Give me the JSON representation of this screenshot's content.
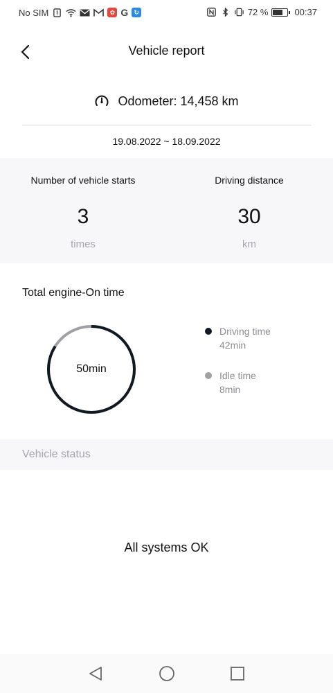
{
  "status_bar": {
    "carrier": "No SIM",
    "battery_percent": "72 %",
    "battery_level": 0.72,
    "time": "00:37",
    "icons": [
      "sim-alert-icon",
      "wifi-icon",
      "mail-icon",
      "gmail-icon",
      "huawei-app-icon",
      "google-icon",
      "app-icon",
      "nfc-icon",
      "bluetooth-icon",
      "vibrate-icon",
      "battery-icon"
    ]
  },
  "header": {
    "title": "Vehicle report",
    "back_icon": "chevron-left-icon"
  },
  "odometer": {
    "icon": "speedometer-icon",
    "text": "Odometer: 14,458 km"
  },
  "date_range": "19.08.2022 ~ 18.09.2022",
  "stats": {
    "starts": {
      "label": "Number of vehicle starts",
      "value": "3",
      "unit": "times"
    },
    "distance": {
      "label": "Driving distance",
      "value": "30",
      "unit": "km"
    }
  },
  "engine": {
    "title": "Total engine-On time",
    "total": "50min",
    "driving": {
      "label": "Driving time",
      "value": "42min",
      "minutes": 42,
      "color": "#111a22"
    },
    "idle": {
      "label": "Idle time",
      "value": "8min",
      "minutes": 8,
      "color": "#a0a0a5"
    }
  },
  "vehicle_status": {
    "section_label": "Vehicle status",
    "message": "All systems OK"
  },
  "nav": {
    "icons": [
      "back-triangle-icon",
      "home-circle-icon",
      "recents-square-icon"
    ]
  }
}
